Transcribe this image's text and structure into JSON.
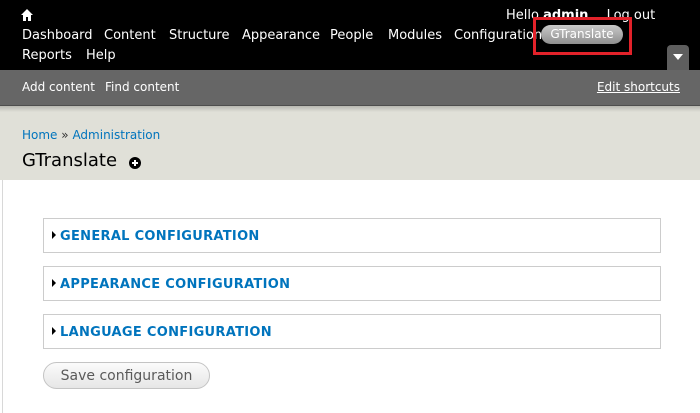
{
  "toolbar": {
    "home_icon": "home-icon",
    "greeting": "Hello",
    "username": "admin",
    "logout": "Log out",
    "menu": [
      {
        "label": "Dashboard"
      },
      {
        "label": "Content"
      },
      {
        "label": "Structure"
      },
      {
        "label": "Appearance"
      },
      {
        "label": "People"
      },
      {
        "label": "Modules"
      },
      {
        "label": "Configuration"
      },
      {
        "label": "GTranslate"
      },
      {
        "label": "Reports"
      },
      {
        "label": "Help"
      }
    ],
    "drawer_toggle_icon": "chevron-down-icon"
  },
  "shortcuts": {
    "items": [
      {
        "label": "Add content"
      },
      {
        "label": "Find content"
      }
    ],
    "edit_label": "Edit shortcuts"
  },
  "breadcrumb": {
    "items": [
      {
        "label": "Home"
      },
      {
        "label": "Administration"
      }
    ],
    "separator": "»"
  },
  "page": {
    "title": "GTranslate"
  },
  "sections": [
    {
      "label": "GENERAL CONFIGURATION"
    },
    {
      "label": "APPEARANCE CONFIGURATION"
    },
    {
      "label": "LANGUAGE CONFIGURATION"
    }
  ],
  "actions": {
    "save_label": "Save configuration"
  },
  "colors": {
    "toolbar_bg": "#000000",
    "shortcuts_bg": "#666666",
    "branding_bg": "#e0e0d8",
    "link": "#0074bd",
    "highlight": "#e2222a"
  }
}
